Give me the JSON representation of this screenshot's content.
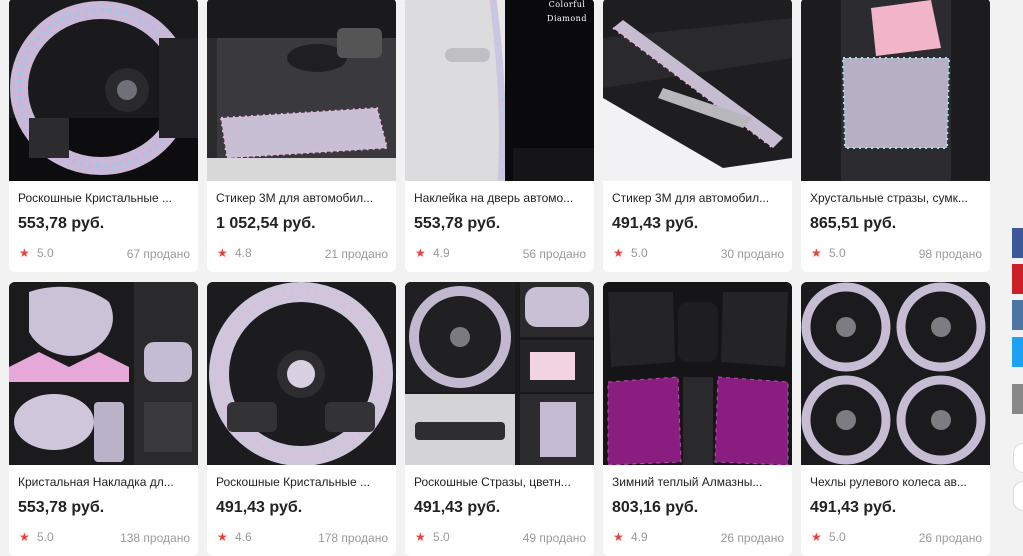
{
  "products": [
    {
      "title": "Роскошные Кристальные ...",
      "price": "553,78 руб.",
      "rating": "5.0",
      "sold": "67 продано"
    },
    {
      "title": "Стикер 3M для автомобил...",
      "price": "1 052,54 руб.",
      "rating": "4.8",
      "sold": "21 продано"
    },
    {
      "title": "Наклейка на дверь автомо...",
      "price": "553,78 руб.",
      "rating": "4.9",
      "sold": "56 продано",
      "image_text": [
        "Colorful",
        "Diamond"
      ]
    },
    {
      "title": "Стикер 3M для автомобил...",
      "price": "491,43 руб.",
      "rating": "5.0",
      "sold": "30 продано"
    },
    {
      "title": "Хрустальные стразы, сумк...",
      "price": "865,51 руб.",
      "rating": "5.0",
      "sold": "98 продано"
    },
    {
      "title": "Кристальная Накладка дл...",
      "price": "553,78 руб.",
      "rating": "5.0",
      "sold": "138 продано"
    },
    {
      "title": "Роскошные Кристальные ...",
      "price": "491,43 руб.",
      "rating": "4.6",
      "sold": "178 продано"
    },
    {
      "title": "Роскошные Стразы, цветн...",
      "price": "491,43 руб.",
      "rating": "5.0",
      "sold": "49 продано"
    },
    {
      "title": "Зимний теплый Алмазны...",
      "price": "803,16 руб.",
      "rating": "4.9",
      "sold": "26 продано"
    },
    {
      "title": "Чехлы рулевого колеса ав...",
      "price": "491,43 руб.",
      "rating": "5.0",
      "sold": "26 продано"
    }
  ],
  "rating_icon": "star-icon",
  "colors": {
    "star": "#e8423c",
    "facebook": "#3b5998",
    "pinterest": "#cb2027",
    "vk": "#4c75a3",
    "twitter": "#1da1f2",
    "other": "#888888"
  },
  "share_buttons": [
    "facebook-icon",
    "pinterest-icon",
    "vk-icon",
    "twitter-icon",
    "share-icon"
  ]
}
